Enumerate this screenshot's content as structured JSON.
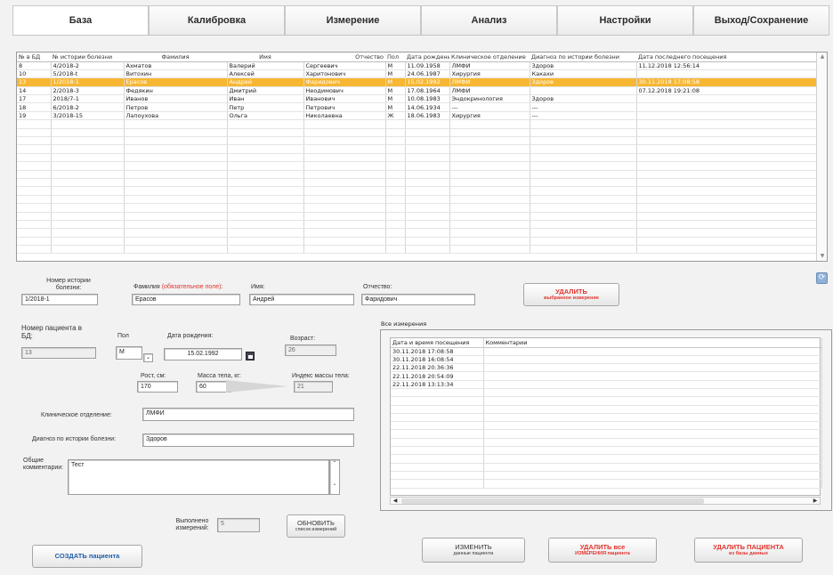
{
  "tabs": [
    "База",
    "Калибровка",
    "Измерение",
    "Анализ",
    "Настройки",
    "Выход/Сохранение"
  ],
  "patients_table": {
    "headers": [
      "№ в БД",
      "№ истории болезни",
      "Фамилия",
      "Имя",
      "Отчество",
      "Пол",
      "Дата рождения",
      "Клиническое отделение",
      "Диагноз по истории болезни",
      "Дата последнего посещения"
    ],
    "rows": [
      [
        "8",
        "4/2018-2",
        "Ахматов",
        "Валерий",
        "Сергеевич",
        "М",
        "11.09.1958",
        "ЛМФИ",
        "Здоров",
        "11.12.2018 12:56:14"
      ],
      [
        "10",
        "5/2018-t",
        "Витохин",
        "Алексей",
        "Харитонович",
        "М",
        "24.06.1987",
        "Хирургия",
        "Какахи",
        ""
      ],
      [
        "13",
        "1/2018-1",
        "Ерасов",
        "Андрей",
        "Фаридович",
        "М",
        "15.02.1992",
        "ЛМФИ",
        "Здоров",
        "30.11.2018 17:08:58"
      ],
      [
        "14",
        "2/2018-3",
        "Федякин",
        "Дмитрий",
        "Неодимович",
        "М",
        "17.08.1964",
        "ЛМФИ",
        "",
        "07.12.2018 19:21:08"
      ],
      [
        "17",
        "2018/7-1",
        "Иванов",
        "Иван",
        "Иванович",
        "М",
        "10.08.1983",
        "Эндокринология",
        "Здоров",
        ""
      ],
      [
        "18",
        "6/2018-2",
        "Петров",
        "Петр",
        "Петрович",
        "М",
        "14.06.1934",
        "---",
        "---",
        ""
      ],
      [
        "19",
        "3/2018-15",
        "Лапоухова",
        "Ольга",
        "Николаевна",
        "Ж",
        "18.06.1983",
        "Хирургия",
        "---",
        ""
      ]
    ]
  },
  "form": {
    "history_label": "Номер истории болезни:",
    "history_value": "1/2018-1",
    "surname_label": "Фамилия",
    "surname_required": "(обязательное поле)",
    "surname_value": "Ерасов",
    "name_label": "Имя:",
    "name_value": "Андрей",
    "patronymic_label": "Отчество:",
    "patronymic_value": "Фаридович",
    "db_number_label": "Номер пациента в БД:",
    "db_number_value": "13",
    "sex_label": "Пол",
    "sex_value": "М",
    "birth_label": "Дата рождения:",
    "birth_value": "15.02.1992",
    "age_label": "Возраст:",
    "age_value": "26",
    "height_label": "Рост, см:",
    "height_value": "170",
    "weight_label": "Масса тела, кг:",
    "weight_value": "60",
    "bmi_label": "Индекс массы тела:",
    "bmi_value": "21",
    "clinic_label": "Клиническое отделение:",
    "clinic_value": "ЛМФИ",
    "diagnosis_label": "Диагноз по истории болезни:",
    "diagnosis_value": "Здоров",
    "comments_label": "Общие комментарии:",
    "comments_value": "Тест",
    "measurements_done_label": "Выполнено измерений:",
    "measurements_done_value": "5"
  },
  "measurements": {
    "title": "Все измерения",
    "headers": [
      "Дата и время посещения",
      "Комментарии"
    ],
    "rows": [
      "30.11.2018 17:08:58",
      "30.11.2018 16:08:54",
      "22.11.2018 20:36:36",
      "22.11.2018 20:54:09",
      "22.11.2018 13:13:34"
    ]
  },
  "buttons": {
    "delete_measurement_l1": "УДАЛИТЬ",
    "delete_measurement_l2": "выбранное измерение",
    "refresh_l1": "ОБНОВИТЬ",
    "refresh_l2": "список измерений",
    "create_patient": "СОЗДАТЬ пациента",
    "edit_l1": "ИЗМЕНИТЬ",
    "edit_l2": "данные пациента",
    "delete_all_l1": "УДАЛИТЬ все",
    "delete_all_l2": "ИЗМЕРЕНИЯ пациента",
    "delete_patient_l1": "УДАЛИТЬ ПАЦИЕНТА",
    "delete_patient_l2": "из базы данных"
  },
  "colors": {
    "selected_row": "#f7b733",
    "danger_text": "#e3342f",
    "primary_text": "#1f5ea8"
  }
}
